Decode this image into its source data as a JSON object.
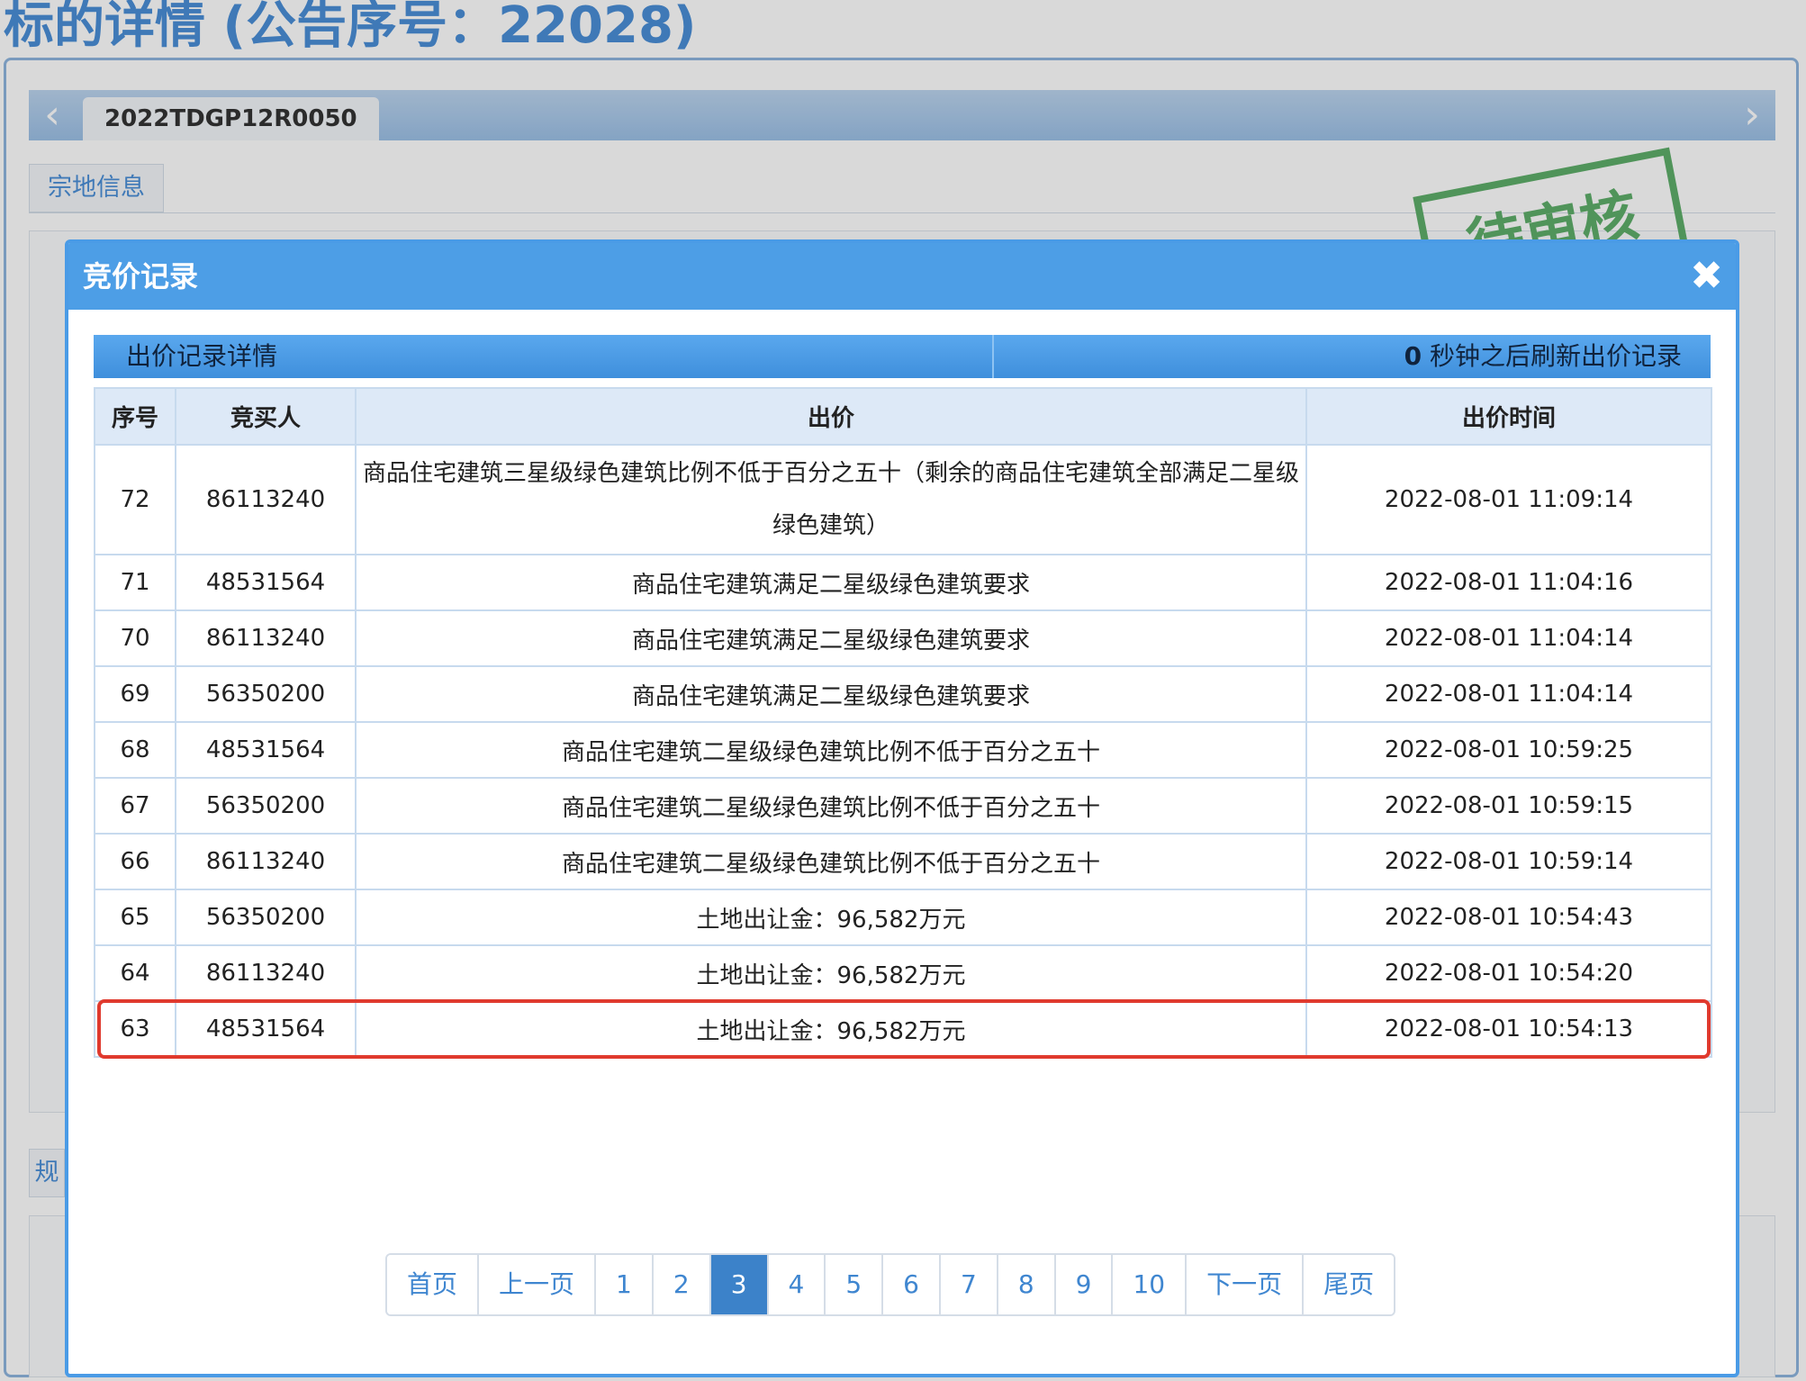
{
  "page": {
    "title": "标的详情 (公告序号：22028)",
    "tab_label": "2022TDGP12R0050",
    "section_label": "宗地信息",
    "partial_section_label": "规",
    "stamp_text": "待审核"
  },
  "modal": {
    "title": "竞价记录",
    "close_symbol": "✖",
    "subheader_left": "出价记录详情",
    "refresh_seconds": "0",
    "refresh_text": " 秒钟之后刷新出价记录"
  },
  "table": {
    "columns": [
      "序号",
      "竞买人",
      "出价",
      "出价时间"
    ],
    "rows": [
      {
        "seq": "72",
        "bidder": "86113240",
        "bid": "商品住宅建筑三星级绿色建筑比例不低于百分之五十（剩余的商品住宅建筑全部满足二星级绿色建筑）",
        "time": "2022-08-01 11:09:14"
      },
      {
        "seq": "71",
        "bidder": "48531564",
        "bid": "商品住宅建筑满足二星级绿色建筑要求",
        "time": "2022-08-01 11:04:16"
      },
      {
        "seq": "70",
        "bidder": "86113240",
        "bid": "商品住宅建筑满足二星级绿色建筑要求",
        "time": "2022-08-01 11:04:14"
      },
      {
        "seq": "69",
        "bidder": "56350200",
        "bid": "商品住宅建筑满足二星级绿色建筑要求",
        "time": "2022-08-01 11:04:14"
      },
      {
        "seq": "68",
        "bidder": "48531564",
        "bid": "商品住宅建筑二星级绿色建筑比例不低于百分之五十",
        "time": "2022-08-01 10:59:25"
      },
      {
        "seq": "67",
        "bidder": "56350200",
        "bid": "商品住宅建筑二星级绿色建筑比例不低于百分之五十",
        "time": "2022-08-01 10:59:15"
      },
      {
        "seq": "66",
        "bidder": "86113240",
        "bid": "商品住宅建筑二星级绿色建筑比例不低于百分之五十",
        "time": "2022-08-01 10:59:14"
      },
      {
        "seq": "65",
        "bidder": "56350200",
        "bid": "土地出让金：96,582万元",
        "time": "2022-08-01 10:54:43"
      },
      {
        "seq": "64",
        "bidder": "86113240",
        "bid": "土地出让金：96,582万元",
        "time": "2022-08-01 10:54:20"
      },
      {
        "seq": "63",
        "bidder": "48531564",
        "bid": "土地出让金：96,582万元",
        "time": "2022-08-01 10:54:13"
      }
    ]
  },
  "pagination": {
    "first": "首页",
    "prev": "上一页",
    "pages": [
      "1",
      "2",
      "3",
      "4",
      "5",
      "6",
      "7",
      "8",
      "9",
      "10"
    ],
    "current": "3",
    "next": "下一页",
    "last": "尾页"
  },
  "colors": {
    "accent": "#4d9ee6",
    "highlight": "#e03a2e",
    "stamp": "#5fae6a",
    "active_page": "#3c82c9"
  },
  "icons": {
    "tab_prev": "chevron-left-icon",
    "tab_next": "chevron-right-icon",
    "close": "close-icon"
  }
}
